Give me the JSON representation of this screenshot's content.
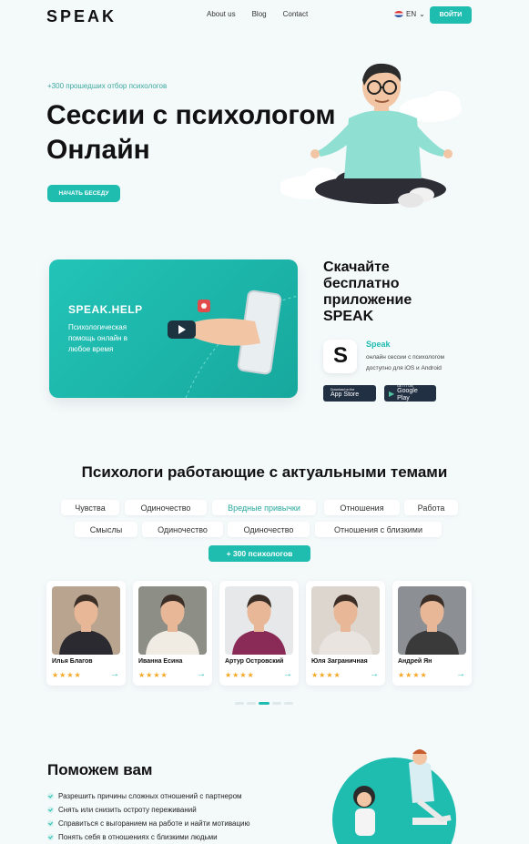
{
  "header": {
    "logo": "SPEAK",
    "nav": [
      "About us",
      "Blog",
      "Contact"
    ],
    "lang": "EN",
    "login": "ВОЙТИ"
  },
  "hero": {
    "subtitle": "+300 прошедших отбор психологов",
    "title": "Сессии с психологом Онлайн",
    "cta": "НАЧАТЬ БЕСЕДУ"
  },
  "video": {
    "title": "SPEAK.HELP",
    "text": "Психологическая помощь онлайн в любое время"
  },
  "download": {
    "title": "Скачайте бесплатно приложение SPEAK",
    "app_name": "Speak",
    "app_desc": "онлайн сессии с психологом доступно для iOS и Android",
    "appstore_small": "Download on the",
    "appstore_large": "App Store",
    "gplay_small": "GET IT ON",
    "gplay_large": "Google Play"
  },
  "topics": {
    "title": "Психологи работающие с актуальными темами",
    "chips": [
      "Чувства",
      "Одиночество",
      "Вредные привычки",
      "Отношения",
      "Работа",
      "Смыслы",
      "Одиночество",
      "Одиночество",
      "Отношения с близкими"
    ],
    "more": "+ 300 психологов"
  },
  "psychologists": [
    {
      "name": "Илья Благов",
      "stars": "★★★★",
      "photo_bg": "#b9a58f",
      "shirt": "#2b2a30"
    },
    {
      "name": "Иванна Есина",
      "stars": "★★★★",
      "photo_bg": "#8d8f86",
      "shirt": "#f1ece3"
    },
    {
      "name": "Артур Островский",
      "stars": "★★★★",
      "photo_bg": "#e6e8ea",
      "shirt": "#8a2a56"
    },
    {
      "name": "Юля Заграничная",
      "stars": "★★★★",
      "photo_bg": "#dcd6cf",
      "shirt": "#e9e4df"
    },
    {
      "name": "Андрей Ян",
      "stars": "★★★★",
      "photo_bg": "#8c8f94",
      "shirt": "#3a3a3a"
    }
  ],
  "help": {
    "title": "Поможем вам",
    "items": [
      "Разрешить причины сложных отношений с партнером",
      "Снять или снизить остроту переживаний",
      "Справиться с выгоранием на работе и найти мотивацию",
      "Понять себя в отношениях с близкими людьми"
    ]
  },
  "colors": {
    "accent": "#1fbcb0",
    "background": "#f4f9fa",
    "star": "#f5a623"
  }
}
